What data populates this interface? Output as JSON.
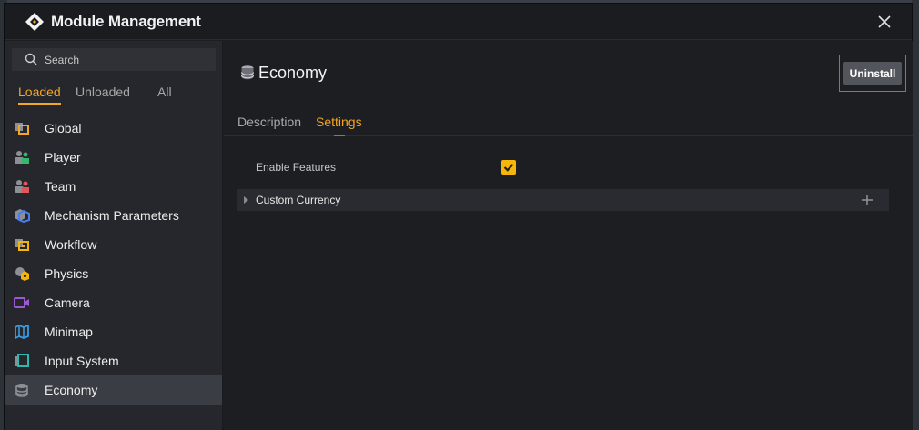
{
  "dialog": {
    "title": "Module Management"
  },
  "sidebar": {
    "search_placeholder": "Search",
    "filter_tabs": [
      {
        "label": "Loaded",
        "active": true
      },
      {
        "label": "Unloaded",
        "active": false
      },
      {
        "label": "All",
        "active": false
      }
    ],
    "modules": [
      {
        "label": "Global",
        "icon": "global-icon"
      },
      {
        "label": "Player",
        "icon": "player-icon"
      },
      {
        "label": "Team",
        "icon": "team-icon"
      },
      {
        "label": "Mechanism Parameters",
        "icon": "mechanism-icon"
      },
      {
        "label": "Workflow",
        "icon": "workflow-icon"
      },
      {
        "label": "Physics",
        "icon": "physics-icon"
      },
      {
        "label": "Camera",
        "icon": "camera-icon"
      },
      {
        "label": "Minimap",
        "icon": "minimap-icon"
      },
      {
        "label": "Input System",
        "icon": "input-system-icon"
      },
      {
        "label": "Economy",
        "icon": "economy-icon",
        "selected": true
      }
    ]
  },
  "content": {
    "title": "Economy",
    "uninstall_label": "Uninstall",
    "tabs": [
      {
        "label": "Description",
        "active": false
      },
      {
        "label": "Settings",
        "active": true
      }
    ],
    "settings": {
      "enable_features_label": "Enable Features",
      "enable_features_checked": true,
      "group_label": "Custom Currency"
    }
  },
  "colors": {
    "accent": "#f5a623",
    "tab_underline": "#9b59d0",
    "checkbox": "#f5b50a",
    "highlight_border": "#e0514d"
  }
}
